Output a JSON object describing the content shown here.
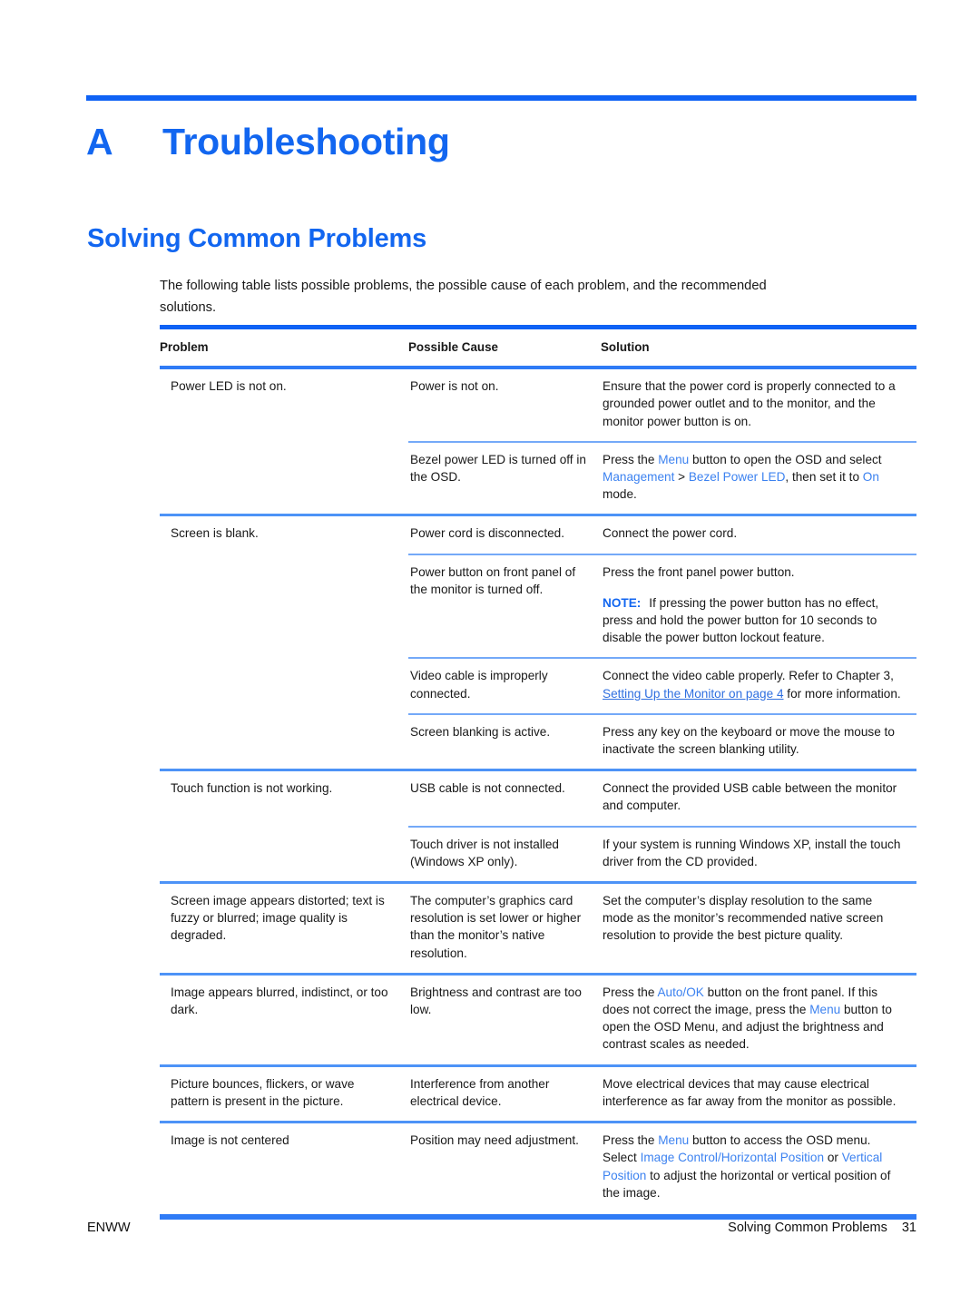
{
  "document": {
    "chapter_letter": "A",
    "chapter_title": "Troubleshooting",
    "section_heading": "Solving Common Problems",
    "intro": "The following table lists possible problems, the possible cause of each problem, and the recommended solutions.",
    "accent_color": "#1266f0",
    "rule_color": "#0f62f5",
    "row_rule_color": "#74a9f8"
  },
  "table": {
    "headers": [
      "Problem",
      "Possible Cause",
      "Solution"
    ],
    "rows": [
      {
        "problem": "Power LED is not on.",
        "causes": [
          {
            "cause": "Power is not on.",
            "solution": "Ensure that the power cord is properly connected to a grounded power outlet and to the monitor, and the monitor power button is on."
          },
          {
            "cause": "Bezel power LED is turned off in the OSD.",
            "solution": "Press the Menu button to open the OSD and select Management > Bezel Power LED, then set it to On mode.",
            "solution_parts": [
              {
                "t": "Press the ",
                "s": "plain"
              },
              {
                "t": "Menu",
                "s": "ui"
              },
              {
                "t": " button to open the OSD and select ",
                "s": "plain"
              },
              {
                "t": "Management",
                "s": "ui"
              },
              {
                "t": " > ",
                "s": "plain"
              },
              {
                "t": "Bezel Power LED",
                "s": "ui"
              },
              {
                "t": ", then set it to ",
                "s": "plain"
              },
              {
                "t": "On",
                "s": "ui"
              },
              {
                "t": " mode.",
                "s": "plain"
              }
            ]
          }
        ]
      },
      {
        "problem": "Screen is blank.",
        "causes": [
          {
            "cause": "Power cord is disconnected.",
            "solution": "Connect the power cord."
          },
          {
            "cause": "Power button on front panel of the monitor is turned off.",
            "solution": "Press the front panel power button.",
            "note_label": "NOTE:",
            "note_text": "If pressing the power button has no effect, press and hold the power button for 10 seconds to disable the power button lockout feature."
          },
          {
            "cause": "Video cable is improperly connected.",
            "solution": "Connect the video cable properly. Refer to Chapter 3, Setting Up the Monitor on page 4 for more information.",
            "solution_parts": [
              {
                "t": "Connect the video cable properly. Refer to Chapter 3, ",
                "s": "plain"
              },
              {
                "t": "Setting Up the Monitor on page 4",
                "s": "lnk"
              },
              {
                "t": " for more information.",
                "s": "plain"
              }
            ]
          },
          {
            "cause": "Screen blanking is active.",
            "solution": "Press any key on the keyboard or move the mouse to inactivate the screen blanking utility."
          }
        ]
      },
      {
        "problem": "Touch function is not working.",
        "causes": [
          {
            "cause": "USB cable is not connected.",
            "solution": "Connect the provided USB cable between the monitor and computer."
          },
          {
            "cause": "Touch driver is not installed (Windows XP only).",
            "solution": "If your system is running Windows XP, install the touch driver from the CD provided."
          }
        ]
      },
      {
        "problem": "Screen image appears distorted; text is fuzzy or blurred; image quality is degraded.",
        "causes": [
          {
            "cause": "The computer’s graphics card resolution is set lower or higher than the monitor’s native resolution.",
            "solution": "Set the computer’s display resolution to the same mode as the monitor’s recommended native screen resolution to provide the best picture quality."
          }
        ]
      },
      {
        "problem": "Image appears blurred, indistinct, or too dark.",
        "causes": [
          {
            "cause": "Brightness and contrast are too low.",
            "solution": "Press the Auto/OK button on the front panel. If this does not correct the image, press the Menu button to open the OSD Menu, and adjust the brightness and contrast scales as needed.",
            "solution_parts": [
              {
                "t": "Press the ",
                "s": "plain"
              },
              {
                "t": "Auto/OK",
                "s": "ui"
              },
              {
                "t": " button on the front panel. If this does not correct the image, press the ",
                "s": "plain"
              },
              {
                "t": "Menu",
                "s": "ui"
              },
              {
                "t": " button to open the OSD Menu, and adjust the brightness and contrast scales as needed.",
                "s": "plain"
              }
            ]
          }
        ]
      },
      {
        "problem": "Picture bounces, flickers, or wave pattern is present in the picture.",
        "causes": [
          {
            "cause": "Interference from another electrical device.",
            "solution": "Move electrical devices that may cause electrical interference as far away from the monitor as possible."
          }
        ]
      },
      {
        "problem": "Image is not centered",
        "causes": [
          {
            "cause": "Position may need adjustment.",
            "solution": "Press the Menu button to access the OSD menu. Select Image Control/Horizontal Position or Vertical Position to adjust the horizontal or vertical position of the image.",
            "solution_parts": [
              {
                "t": "Press the ",
                "s": "plain"
              },
              {
                "t": "Menu",
                "s": "ui"
              },
              {
                "t": " button to access the OSD menu. Select ",
                "s": "plain"
              },
              {
                "t": "Image Control/Horizontal Position",
                "s": "ui"
              },
              {
                "t": " or ",
                "s": "plain"
              },
              {
                "t": "Vertical Position",
                "s": "ui"
              },
              {
                "t": " to adjust the horizontal or vertical position of the image.",
                "s": "plain"
              }
            ]
          }
        ]
      }
    ]
  },
  "footer": {
    "left": "ENWW",
    "section": "Solving Common Problems",
    "page_number": "31"
  }
}
